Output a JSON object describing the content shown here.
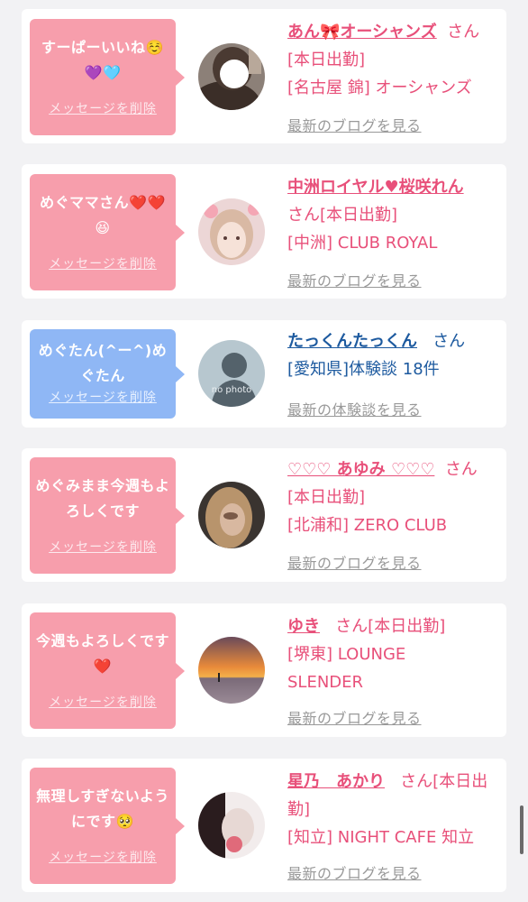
{
  "conversations": [
    {
      "bubble_color": "#f79eac",
      "message": "すーぱーいいね☺️💜🩵",
      "delete_label": "メッセージを削除",
      "name": "あん🎀オーシャンズ",
      "name_color": "#e8507a",
      "suffix": "さん[本日出勤]",
      "shop": "[名古屋 錦] オーシャンズ",
      "blog_link": "最新のブログを見る",
      "avatar_icon": "girl-photo"
    },
    {
      "bubble_color": "#f79eac",
      "message": "めぐママさん❤️❤️😆",
      "delete_label": "メッセージを削除",
      "name": "中洲ロイヤル♥桜咲れん",
      "name_color": "#e8507a",
      "suffix": "さん[本日出勤]",
      "shop": "[中洲] CLUB ROYAL",
      "blog_link": "最新のブログを見る",
      "avatar_icon": "girl-photo"
    },
    {
      "bubble_color": "#8fb7f5",
      "message": "めぐたん(^ー^)めぐたん",
      "delete_label": "メッセージを削除",
      "name": "たっくんたっくん",
      "name_color": "#1d5a9f",
      "suffix": "さん",
      "shop": "[愛知県]体験談 18件",
      "blog_link": "最新の体験談を見る",
      "avatar_icon": "no-photo",
      "no_photo_text": "no photo"
    },
    {
      "bubble_color": "#f79eac",
      "message": "めぐみまま今週もよろしくです",
      "delete_label": "メッセージを削除",
      "name": "♡♡♡ あゆみ ♡♡♡",
      "name_color": "#e8507a",
      "suffix": "さん[本日出勤]",
      "shop": "[北浦和] ZERO CLUB",
      "blog_link": "最新のブログを見る",
      "avatar_icon": "girl-photo"
    },
    {
      "bubble_color": "#f79eac",
      "message": "今週もよろしくです❤️",
      "delete_label": "メッセージを削除",
      "name": "ゆき",
      "name_color": "#e8507a",
      "suffix": "さん[本日出勤]",
      "shop": "[堺東] LOUNGE SLENDER",
      "blog_link": "最新のブログを見る",
      "avatar_icon": "sunset-photo"
    },
    {
      "bubble_color": "#f79eac",
      "message": "無理しすぎないようにです🥺",
      "delete_label": "メッセージを削除",
      "name": "星乃　あかり",
      "name_color": "#e8507a",
      "suffix": "さん[本日出勤]",
      "shop": "[知立] NIGHT CAFE 知立",
      "blog_link": "最新のブログを見る",
      "avatar_icon": "girl-photo"
    }
  ]
}
